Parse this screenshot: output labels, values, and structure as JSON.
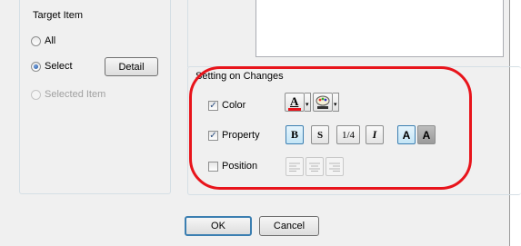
{
  "target_item": {
    "title": "Target Item",
    "options": [
      {
        "label": "All",
        "checked": false,
        "disabled": false
      },
      {
        "label": "Select",
        "checked": true,
        "disabled": false
      },
      {
        "label": "Selected Item",
        "checked": false,
        "disabled": true
      }
    ],
    "detail_button": "Detail"
  },
  "setting_on_changes": {
    "title": "Setting on Changes",
    "color": {
      "label": "Color",
      "checked": true,
      "font_color_glyph": "A",
      "font_color_bar": "#e8141b"
    },
    "property": {
      "label": "Property",
      "checked": true,
      "buttons": [
        "B",
        "S",
        "1/4",
        "I",
        "A",
        "A"
      ]
    },
    "position": {
      "label": "Position",
      "checked": false
    }
  },
  "footer": {
    "ok": "OK",
    "cancel": "Cancel"
  },
  "annotation_color": "#e8141b"
}
